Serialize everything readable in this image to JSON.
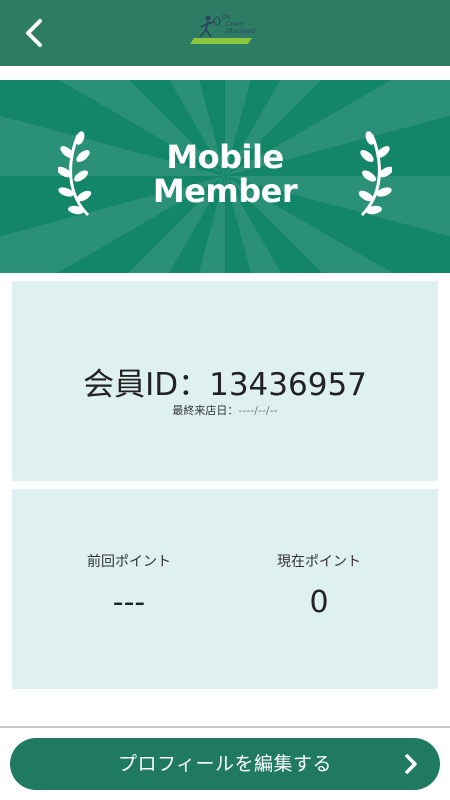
{
  "header": {
    "back_icon": "chevron-left-icon",
    "logo_text": "On\n  Court\n  (Racquet)",
    "bar_color": "#2e7c63"
  },
  "banner": {
    "title_line1": "Mobile",
    "title_line2": "Member",
    "laurel_icon": "laurel-icon",
    "color": "#138568"
  },
  "member": {
    "id_text": "会員ID：13436957",
    "last_visit_label": "最終来店日：",
    "last_visit_value": "----/--/--"
  },
  "points": {
    "previous_label": "前回ポイント",
    "previous_value": "---",
    "current_label": "現在ポイント",
    "current_value": "0"
  },
  "footer": {
    "edit_profile_label": "プロフィールを編集する",
    "chevron_icon": "chevron-right-icon",
    "button_color": "#1f7a61"
  }
}
